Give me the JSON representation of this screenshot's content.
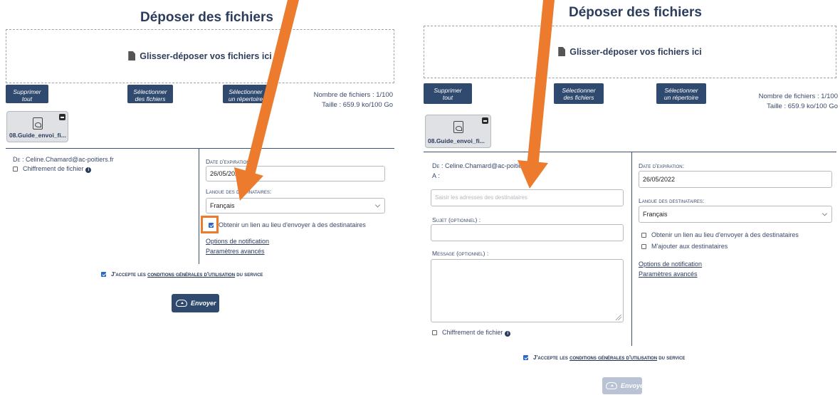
{
  "left": {
    "title": "Déposer des fichiers",
    "dropzone_label": "Glisser-déposer vos fichiers ici",
    "buttons": {
      "clear_all": [
        "Supprimer",
        "tout"
      ],
      "select_files": [
        "Sélectionner",
        "des fichiers"
      ],
      "select_dir": [
        "Sélectionner",
        "un répertoire"
      ]
    },
    "stats": {
      "count": "Nombre de fichiers : 1/100",
      "size": "Taille : 659.9 ko/100 Go"
    },
    "file": {
      "name": "08.Guide_envoi_fi..."
    },
    "from_label": "De :",
    "from_value": "Celine.Chamard@ac-poitiers.fr",
    "encryption": {
      "label": "Chiffrement de fichier",
      "checked": false
    },
    "expiry": {
      "label": "Date d'expiration:",
      "value": "26/05/2022"
    },
    "language": {
      "label": "Langue des destinataires:",
      "value": "Français"
    },
    "get_link": {
      "label": "Obtenir un lien au lieu d'envoyer à des destinataires",
      "checked": true
    },
    "notification_link": "Options de notification",
    "advanced_link": "Paramètres avancés",
    "terms": {
      "prefix": "J'accepte les",
      "link": "conditions générales d'utilisation",
      "suffix": "du service",
      "checked": true
    },
    "send_label": "Envoyer"
  },
  "right": {
    "title": "Déposer des fichiers",
    "dropzone_label": "Glisser-déposer vos fichiers ici",
    "buttons": {
      "clear_all": [
        "Supprimer",
        "tout"
      ],
      "select_files": [
        "Sélectionner",
        "des fichiers"
      ],
      "select_dir": [
        "Sélectionner",
        "un répertoire"
      ]
    },
    "stats": {
      "count": "Nombre de fichiers : 1/100",
      "size": "Taille : 659.9 ko/100 Go"
    },
    "file": {
      "name": "08.Guide_envoi_fi..."
    },
    "from_label": "De :",
    "from_value": "Celine.Chamard@ac-poitiers.fr",
    "to_label": "A :",
    "to_placeholder": "Saisir les adresses des destinataires",
    "subject_label": "Sujet (optionnel) :",
    "message_label": "Message (optionnel) :",
    "encryption": {
      "label": "Chiffrement de fichier",
      "checked": false
    },
    "expiry": {
      "label": "Date d'expiration:",
      "value": "26/05/2022"
    },
    "language": {
      "label": "Langue des destinataires:",
      "value": "Français"
    },
    "get_link": {
      "label": "Obtenir un lien au lieu d'envoyer à des destinataires",
      "checked": false
    },
    "add_me": {
      "label": "M'ajouter aux destinataires",
      "checked": false
    },
    "notification_link": "Options de notification",
    "advanced_link": "Paramètres avancés",
    "terms": {
      "prefix": "J'accepte les",
      "link": "conditions générales d'utilisation",
      "suffix": "du service",
      "checked": true
    },
    "send_label": "Envoyer"
  },
  "colors": {
    "arrow": "#ec7b2d",
    "navy": "#2f4a6e",
    "highlight": "#ec7b2d",
    "send_disabled": "#b9c3d3"
  }
}
